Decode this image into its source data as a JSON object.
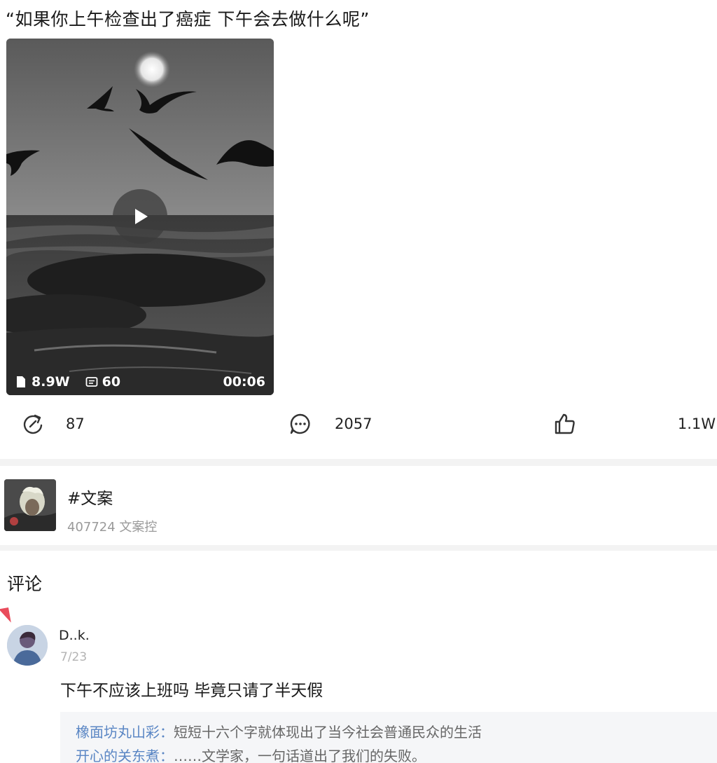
{
  "post": {
    "title": "“如果你上午检查出了癌症 下午会去做什么呢”"
  },
  "video": {
    "views": "8.9W",
    "danmaku": "60",
    "duration": "00:06"
  },
  "actions": {
    "share_count": "87",
    "comment_count": "2057",
    "like_count": "1.1W"
  },
  "topic": {
    "name": "#文案",
    "meta": "407724 文案控"
  },
  "comments_section": {
    "label": "评论"
  },
  "comment": {
    "user": "D..k.",
    "date": "7/23",
    "text": "下午不应该上班吗   毕竟只请了半天假",
    "replies": [
      {
        "user": "橡面坊丸山彩：",
        "text": "短短十六个字就体现出了当今社会普通民众的生活"
      },
      {
        "user": "开心的关东煮：",
        "text": "……文学家，一句话道出了我们的失败。"
      }
    ]
  },
  "icons": {
    "share": "share-icon",
    "comment": "comment-icon",
    "like": "thumbs-up-icon",
    "play": "play-icon",
    "views": "document-icon",
    "danmaku": "danmaku-icon"
  }
}
